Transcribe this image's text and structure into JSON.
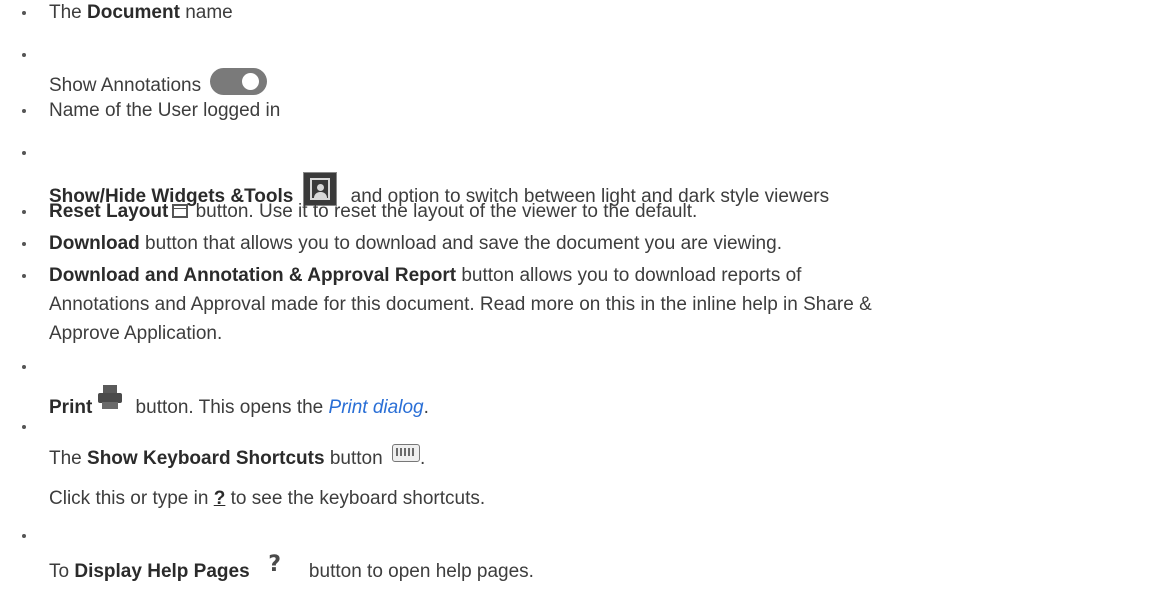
{
  "items": [
    {
      "pre": "The ",
      "bold": "Document",
      "post": " name"
    },
    {
      "text": "Show Annotations",
      "icon": "toggle-icon"
    },
    {
      "text": "Name of the User logged in"
    },
    {
      "bold": "Show/Hide Widgets &Tools",
      "post": " and option to switch between light and dark style viewers",
      "icon": "widgets-tools-icon"
    },
    {
      "bold": "Reset Layout",
      "post": " button. Use it to reset the layout of the viewer to the default.",
      "icon": "reset-layout-icon"
    },
    {
      "bold": "Download",
      "post": " button that allows you to download and save the document you are viewing."
    },
    {
      "bold": "Download and Annotation & Approval Report",
      "post": " button allows you to download reports of",
      "line2": "Annotations and Approval made for this document. Read more on this in the inline help in Share &",
      "line3": "Approve Application."
    },
    {
      "bold": "Print",
      "post": " button. This opens the ",
      "link": "Print dialog",
      "tail": ".",
      "icon": "print-icon"
    },
    {
      "pre": "The ",
      "bold": "Show Keyboard Shortcuts",
      "post": " button ",
      "tail": ".",
      "icon": "keyboard-icon",
      "sub_pre": "Click this or type in ",
      "sub_key": "?",
      "sub_post": " to see the keyboard shortcuts."
    },
    {
      "pre": "To ",
      "bold": "Display Help Pages",
      "post": " button to open help pages.",
      "icon": "help-icon",
      "icon_glyph": "?"
    }
  ]
}
